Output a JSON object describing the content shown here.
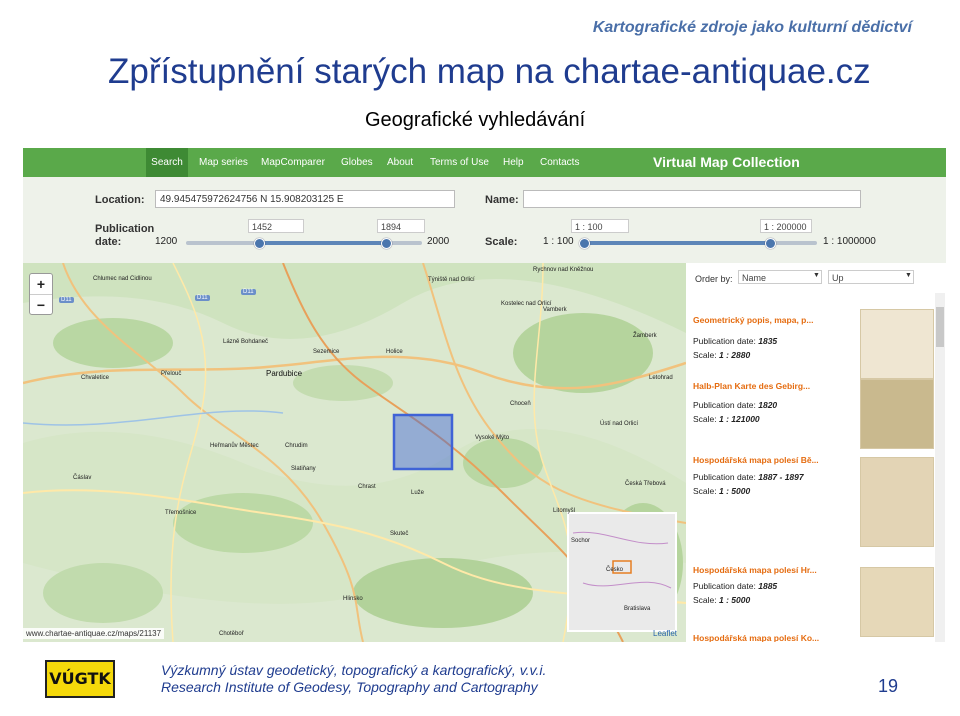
{
  "slide": {
    "header_top": "Kartografické zdroje jako kulturní dědictví",
    "title": "Zpřístupnění starých map na chartae-antiquae.cz",
    "subtitle": "Geografické vyhledávání",
    "footer_line1": "Výzkumný ústav geodetický, topografický a kartografický, v.v.i.",
    "footer_line2": "Research Institute of Geodesy, Topography and Cartography",
    "page_number": "19",
    "logo_text": "VÚGTK"
  },
  "nav": {
    "items": [
      "Search",
      "Map series",
      "MapComparer",
      "Globes",
      "About",
      "Terms of Use",
      "Help",
      "Contacts"
    ],
    "active": "Search",
    "brand": "Virtual Map Collection",
    "color": "#5aa94a"
  },
  "form": {
    "location_label": "Location:",
    "location_value": "49.945475972624756 N 15.908203125 E",
    "name_label": "Name:",
    "name_value": "",
    "pubdate_label": "Publication date:",
    "pubdate_min": "1200",
    "pubdate_max": "2000",
    "pubdate_from": "1452",
    "pubdate_to": "1894",
    "scale_label": "Scale:",
    "scale_min": "1 : 100",
    "scale_max": "1 : 1000000",
    "scale_from": "1 : 100",
    "scale_to": "1 : 200000"
  },
  "map": {
    "zoom_in": "+",
    "zoom_out": "−",
    "url": "www.chartae-antiquae.cz/maps/21137",
    "attribution": "Leaflet",
    "labels": [
      "Chlumec nad Cidlinou",
      "Týniště nad Orlicí",
      "Rychnov nad Kněžnou",
      "Kostelec nad Orlicí",
      "Vamberk",
      "Lázně Bohdaneč",
      "Sezemice",
      "Holice",
      "Přelouč",
      "Pardubice",
      "Chvaletice",
      "Choceň",
      "Vysoké Mýto",
      "Ústí nad Orlicí",
      "Heřmanův Městec",
      "Chrudim",
      "Slatiňany",
      "Čáslav",
      "Chrast",
      "Luže",
      "Třemošnice",
      "Skuteč",
      "Hlinsko",
      "Chotěboř",
      "Žamberk",
      "Letohrad",
      "Česká Třebová",
      "Litomyšl",
      "Bratislava",
      "Česko",
      "Sochor"
    ],
    "road_labels": [
      "D11",
      "D11",
      "D11"
    ]
  },
  "results": {
    "order_label": "Order by:",
    "order_value": "Name",
    "direction_value": "Up",
    "items": [
      {
        "title": "Geometrický popis, mapa, p...",
        "date_label": "Publication date:",
        "date": "1835",
        "scale_label": "Scale:",
        "scale": "1 : 2880"
      },
      {
        "title": "Halb-Plan Karte des Gebirg...",
        "date_label": "Publication date:",
        "date": "1820",
        "scale_label": "Scale:",
        "scale": "1 : 121000"
      },
      {
        "title": "Hospodářská mapa polesí Bě...",
        "date_label": "Publication date:",
        "date": "1887 - 1897",
        "scale_label": "Scale:",
        "scale": "1 : 5000"
      },
      {
        "title": "Hospodářská mapa polesí Hr...",
        "date_label": "Publication date:",
        "date": "1885",
        "scale_label": "Scale:",
        "scale": "1 : 5000"
      },
      {
        "title": "Hospodářská mapa polesí Ko...",
        "date_label": "",
        "date": "",
        "scale_label": "",
        "scale": ""
      }
    ]
  },
  "colors": {
    "title": "#1f3c8f",
    "header": "#4a6fa8",
    "result_title": "#e56c10",
    "selection": "#3f63d6"
  }
}
